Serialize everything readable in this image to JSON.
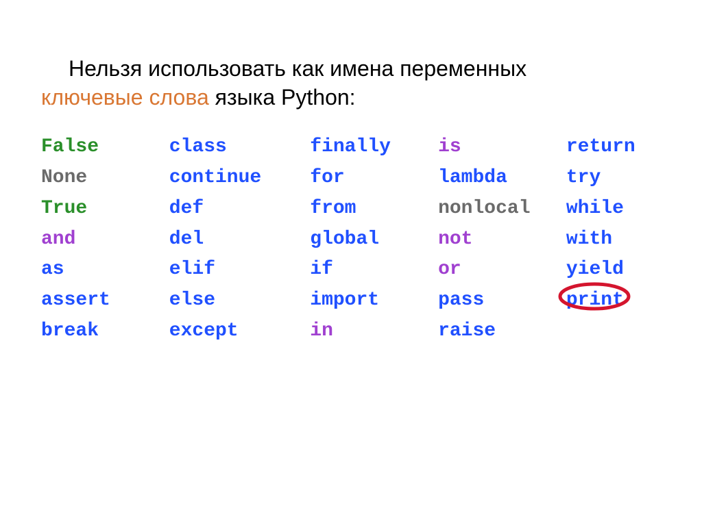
{
  "heading": {
    "part1": "Нельзя использовать как имена переменных",
    "part2_orange": "ключевые слова",
    "part3": " языка Python:"
  },
  "columns": [
    [
      {
        "text": "False",
        "cls": "c-green"
      },
      {
        "text": "None",
        "cls": "c-gray"
      },
      {
        "text": "True",
        "cls": "c-true"
      },
      {
        "text": "and",
        "cls": "c-purple"
      },
      {
        "text": "as",
        "cls": "c-blue"
      },
      {
        "text": "assert",
        "cls": "c-blue"
      },
      {
        "text": "break",
        "cls": "c-blue"
      }
    ],
    [
      {
        "text": "class",
        "cls": "c-blue"
      },
      {
        "text": "continue",
        "cls": "c-blue"
      },
      {
        "text": "def",
        "cls": "c-blue"
      },
      {
        "text": "del",
        "cls": "c-blue"
      },
      {
        "text": "elif",
        "cls": "c-blue"
      },
      {
        "text": "else",
        "cls": "c-blue"
      },
      {
        "text": "except",
        "cls": "c-blue"
      }
    ],
    [
      {
        "text": "finally",
        "cls": "c-blue"
      },
      {
        "text": "for",
        "cls": "c-blue"
      },
      {
        "text": "from",
        "cls": "c-blue"
      },
      {
        "text": "global",
        "cls": "c-blue"
      },
      {
        "text": "if",
        "cls": "c-blue"
      },
      {
        "text": "import",
        "cls": "c-blue"
      },
      {
        "text": "in",
        "cls": "c-purple"
      }
    ],
    [
      {
        "text": "is",
        "cls": "c-purple"
      },
      {
        "text": "lambda",
        "cls": "c-blue"
      },
      {
        "text": "nonlocal",
        "cls": "c-gray"
      },
      {
        "text": "not",
        "cls": "c-purple"
      },
      {
        "text": "or",
        "cls": "c-purple"
      },
      {
        "text": "pass",
        "cls": "c-blue"
      },
      {
        "text": "raise",
        "cls": "c-blue"
      }
    ],
    [
      {
        "text": "return",
        "cls": "c-blue"
      },
      {
        "text": "try",
        "cls": "c-blue"
      },
      {
        "text": "while",
        "cls": "c-blue"
      },
      {
        "text": "with",
        "cls": "c-blue"
      },
      {
        "text": "yield",
        "cls": "c-blue"
      },
      {
        "text": "print",
        "cls": "c-blue",
        "circled": true
      }
    ]
  ]
}
